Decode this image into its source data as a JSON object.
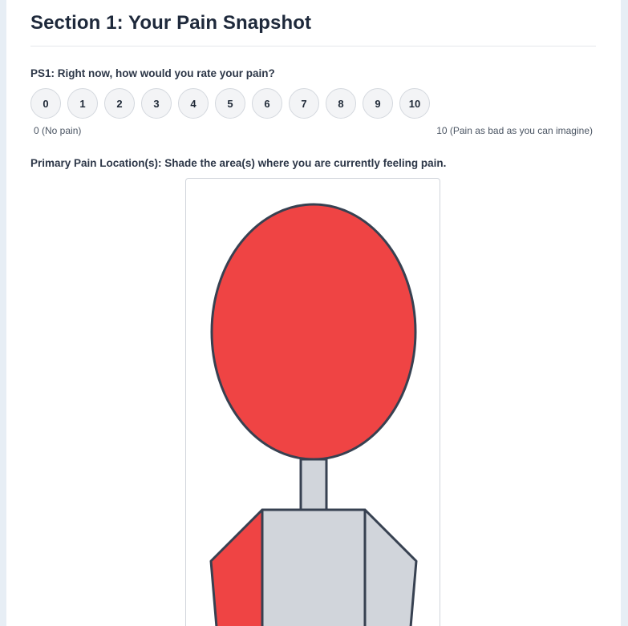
{
  "section": {
    "title": "Section 1: Your Pain Snapshot"
  },
  "ps1": {
    "question": "PS1: Right now, how would you rate your pain?",
    "options": [
      "0",
      "1",
      "2",
      "3",
      "4",
      "5",
      "6",
      "7",
      "8",
      "9",
      "10"
    ],
    "anchor_low": "0 (No pain)",
    "anchor_high": "10 (Pain as bad as you can imagine)"
  },
  "pain_location": {
    "question": "Primary Pain Location(s): Shade the area(s) where you are currently feeling pain.",
    "regions": [
      {
        "name": "head",
        "shaded": true
      },
      {
        "name": "neck",
        "shaded": false
      },
      {
        "name": "chest",
        "shaded": false
      },
      {
        "name": "right-arm",
        "shaded": true
      },
      {
        "name": "left-arm",
        "shaded": false
      }
    ]
  },
  "colors": {
    "shaded": "#ef4444",
    "unshaded": "#d1d5db",
    "outline": "#374151"
  }
}
